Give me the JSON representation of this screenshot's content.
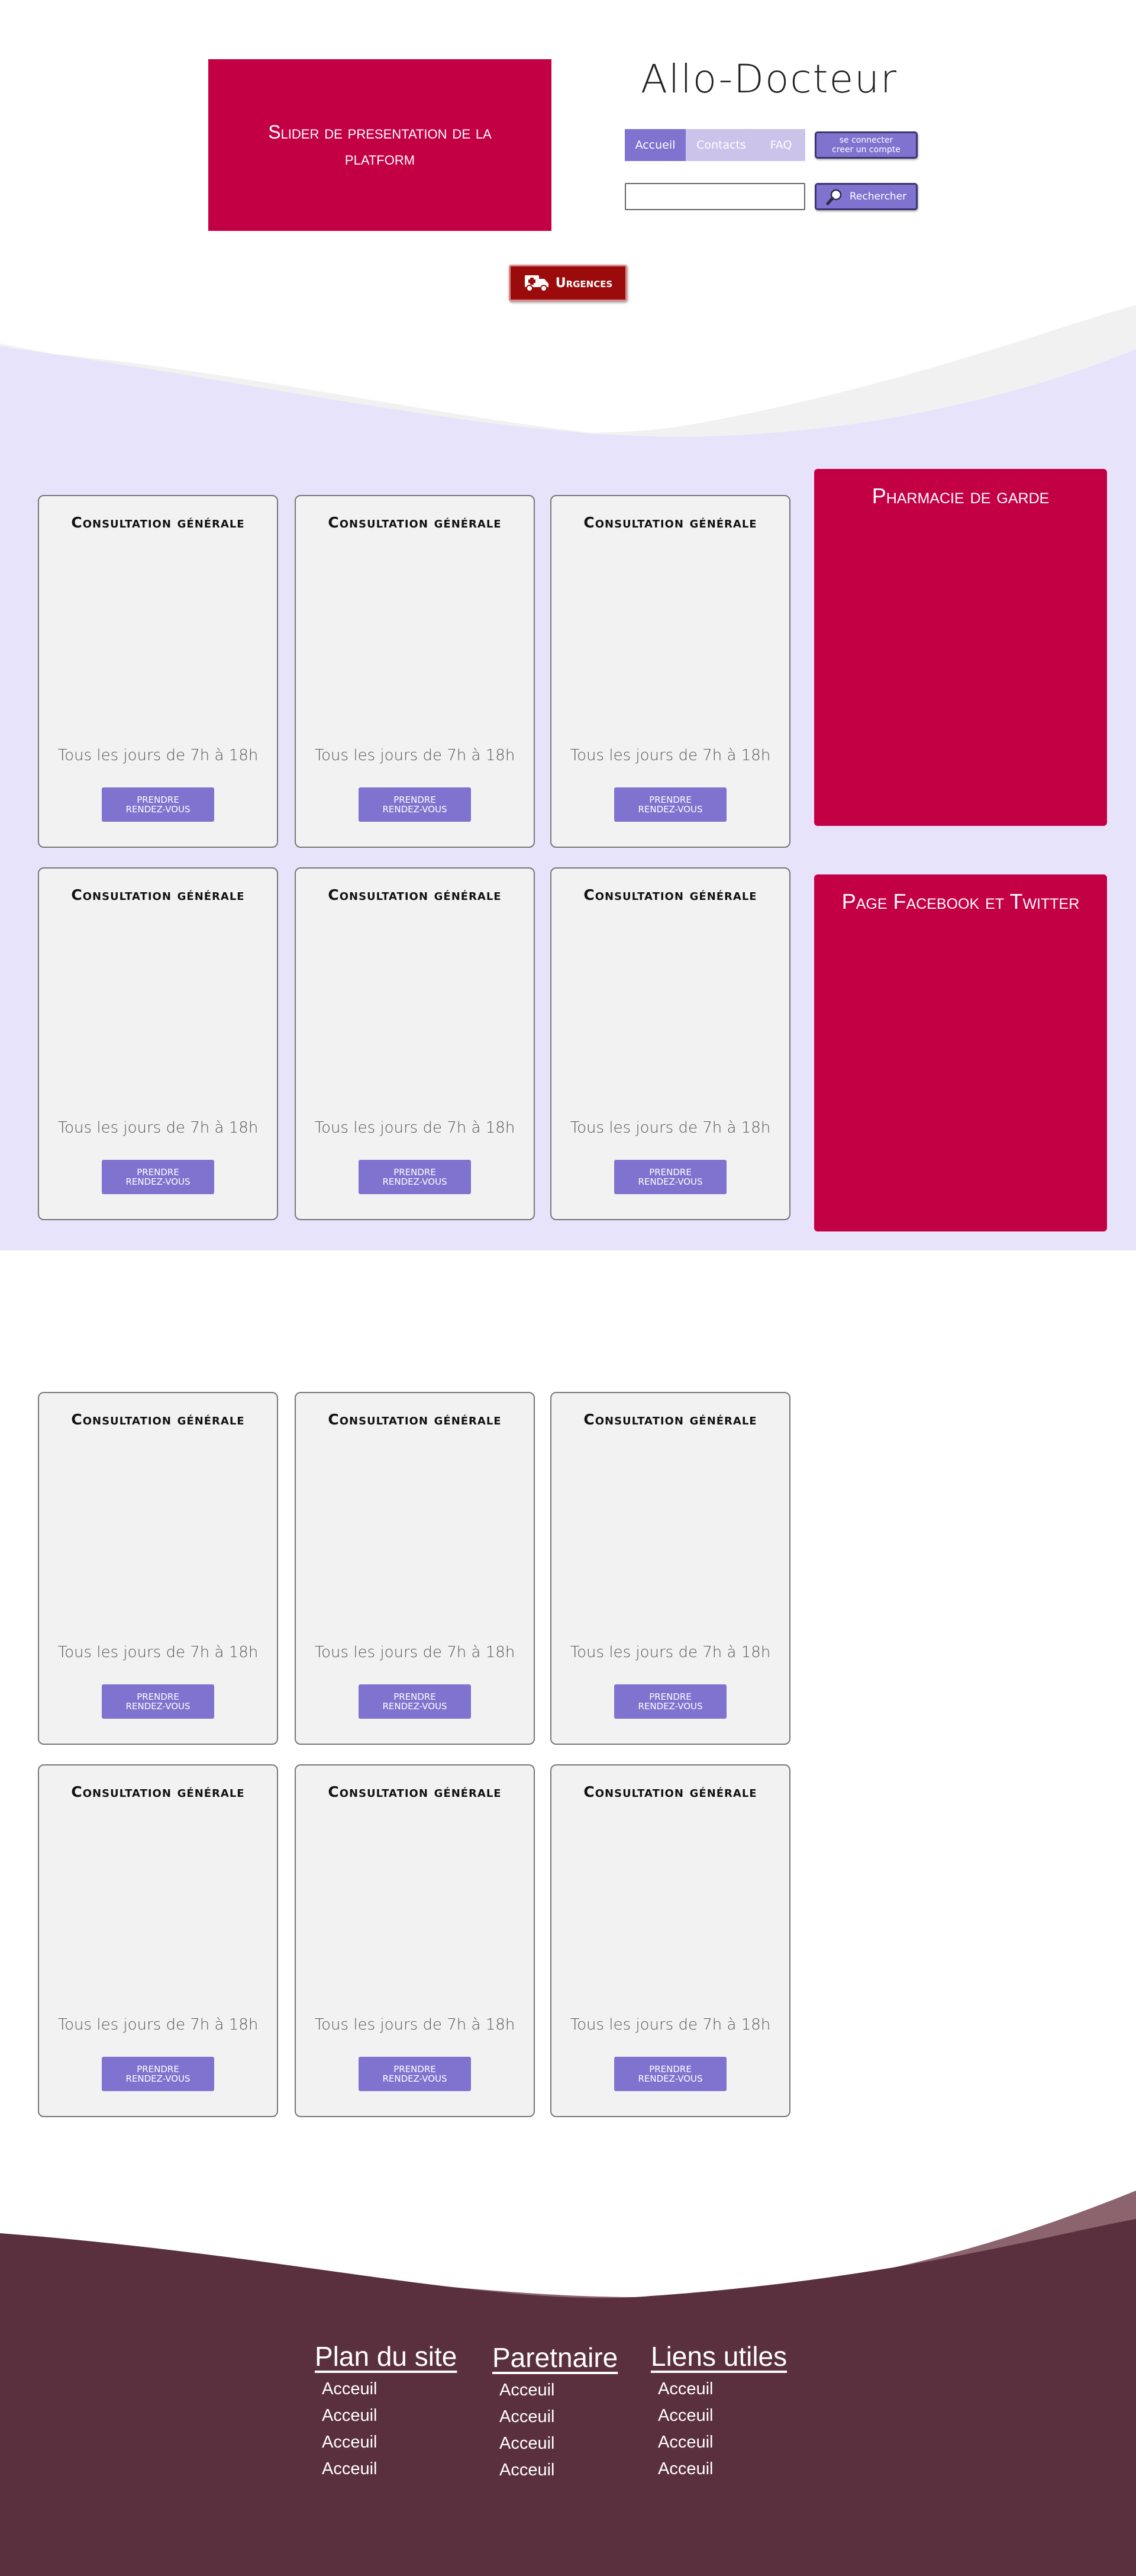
{
  "header": {
    "slider_text": "Slider de presentation de la platform",
    "site_title": "Allo-Docteur",
    "nav": [
      "Accueil",
      "Contacts",
      "FAQ"
    ],
    "login_line1": "se connecter",
    "login_line2": "creer un compte",
    "search_placeholder": "",
    "search_label": "Rechercher",
    "urgence_label": "Urgences"
  },
  "cards": [
    {
      "title": "Consultation générale",
      "hours": "Tous les jours de 7h à 18h",
      "btn1": "Prendre",
      "btn2": "Rendez-vous"
    },
    {
      "title": "Consultation générale",
      "hours": "Tous les jours de 7h à 18h",
      "btn1": "Prendre",
      "btn2": "Rendez-vous"
    },
    {
      "title": "Consultation générale",
      "hours": "Tous les jours de 7h à 18h",
      "btn1": "Prendre",
      "btn2": "Rendez-vous"
    },
    {
      "title": "Consultation générale",
      "hours": "Tous les jours de 7h à 18h",
      "btn1": "Prendre",
      "btn2": "Rendez-vous"
    },
    {
      "title": "Consultation générale",
      "hours": "Tous les jours de 7h à 18h",
      "btn1": "Prendre",
      "btn2": "Rendez-vous"
    },
    {
      "title": "Consultation générale",
      "hours": "Tous les jours de 7h à 18h",
      "btn1": "Prendre",
      "btn2": "Rendez-vous"
    },
    {
      "title": "Consultation générale",
      "hours": "Tous les jours de 7h à 18h",
      "btn1": "Prendre",
      "btn2": "Rendez-vous"
    },
    {
      "title": "Consultation générale",
      "hours": "Tous les jours de 7h à 18h",
      "btn1": "Prendre",
      "btn2": "Rendez-vous"
    },
    {
      "title": "Consultation générale",
      "hours": "Tous les jours de 7h à 18h",
      "btn1": "Prendre",
      "btn2": "Rendez-vous"
    },
    {
      "title": "Consultation générale",
      "hours": "Tous les jours de 7h à 18h",
      "btn1": "Prendre",
      "btn2": "Rendez-vous"
    },
    {
      "title": "Consultation générale",
      "hours": "Tous les jours de 7h à 18h",
      "btn1": "Prendre",
      "btn2": "Rendez-vous"
    },
    {
      "title": "Consultation générale",
      "hours": "Tous les jours de 7h à 18h",
      "btn1": "Prendre",
      "btn2": "Rendez-vous"
    }
  ],
  "side_panels": {
    "pharmacie": "Pharmacie de garde",
    "social": "Page Facebook et Twitter"
  },
  "footer": {
    "columns": [
      {
        "title": "Plan du site",
        "links": [
          "Acceuil",
          "Acceuil",
          "Acceuil",
          "Acceuil"
        ]
      },
      {
        "title": "Paretnaire",
        "links": [
          "Acceuil",
          "Acceuil",
          "Acceuil",
          "Acceuil"
        ]
      },
      {
        "title": "Liens utiles",
        "links": [
          "Acceuil",
          "Acceuil",
          "Acceuil",
          "Acceuil"
        ]
      }
    ]
  },
  "colors": {
    "accent": "#8073d0",
    "brand": "#c40044",
    "lavender_bg": "#e7e3fb",
    "footer_bg": "#5a303e",
    "urgence": "#9b0b0b"
  },
  "icons": [
    "truck-icon",
    "search-icon"
  ]
}
